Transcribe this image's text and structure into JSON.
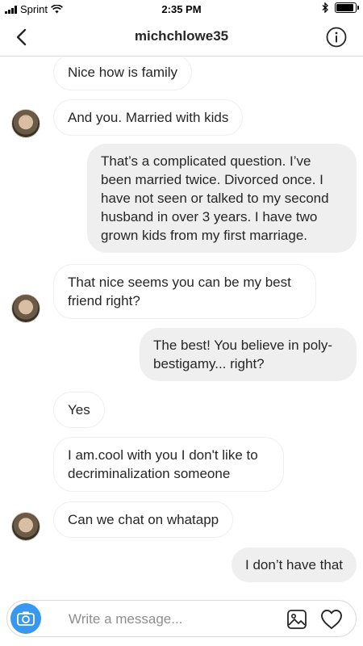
{
  "status_bar": {
    "carrier": "Sprint",
    "time": "2:35 PM",
    "signal_icon": "signal-bars-icon",
    "wifi_icon": "wifi-icon",
    "bluetooth_icon": "bluetooth-icon",
    "battery_icon": "battery-icon",
    "battery_level": 0.9
  },
  "header": {
    "username": "michchlowe35",
    "back_icon": "chevron-left-icon",
    "info_icon": "info-icon"
  },
  "messages": [
    {
      "direction": "in",
      "text": "Nice how is family",
      "avatar": false
    },
    {
      "direction": "in",
      "text": "And you. Married with kids",
      "avatar": true
    },
    {
      "direction": "out",
      "text": "That’s a complicated question. I’ve been married twice. Divorced once.  I have not seen or talked to my second husband in over 3 years. I have two grown kids from my first marriage."
    },
    {
      "direction": "in",
      "text": "That nice seems you can be my best friend right?",
      "avatar": true
    },
    {
      "direction": "out",
      "text": "The best! You believe in poly-bestigamy... right?"
    },
    {
      "direction": "in",
      "text": "Yes",
      "avatar": false
    },
    {
      "direction": "in",
      "text": "I am.cool with you I don't like to decriminalization someone",
      "avatar": false
    },
    {
      "direction": "in",
      "text": "Can we chat on whatapp",
      "avatar": true
    },
    {
      "direction": "out",
      "text": "I don’t have that"
    }
  ],
  "composer": {
    "placeholder": "Write a message...",
    "value": "",
    "camera_icon": "camera-icon",
    "gallery_icon": "image-gallery-icon",
    "heart_icon": "heart-icon"
  },
  "colors": {
    "accent": "#3897f0",
    "outgoing_bubble": "#efefef",
    "text": "#262626",
    "placeholder": "#8e8e8e"
  }
}
